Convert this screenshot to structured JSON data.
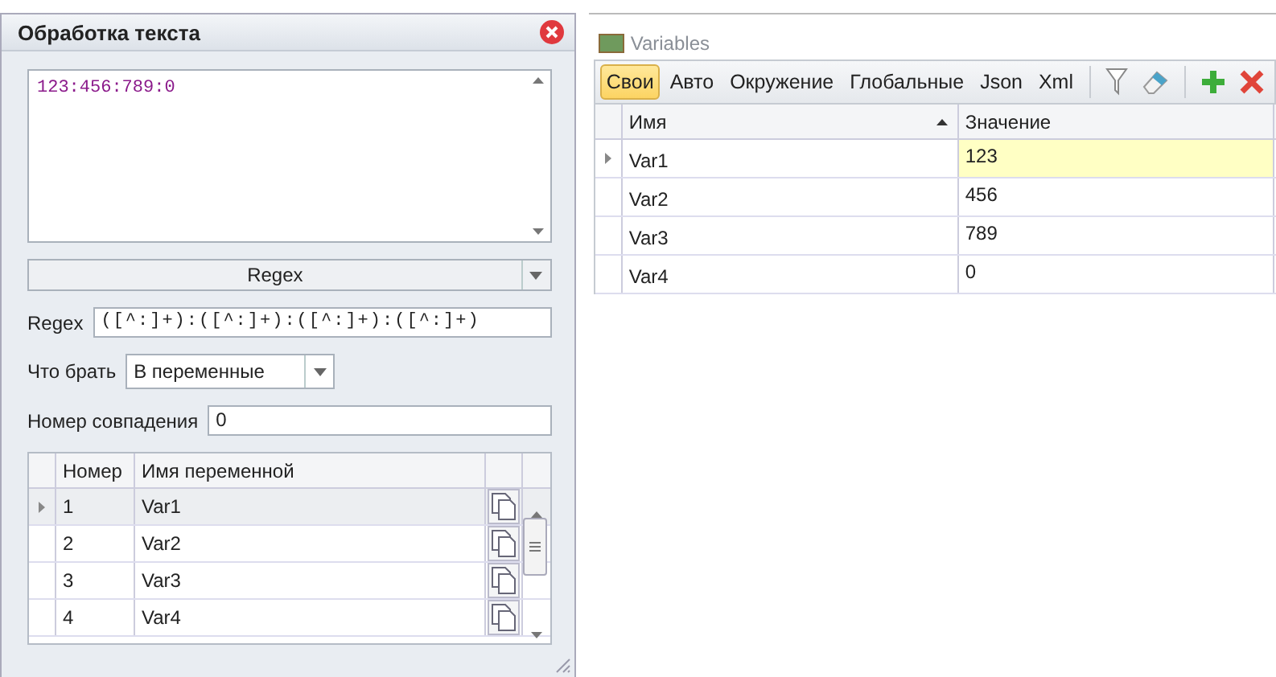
{
  "panel": {
    "title": "Обработка текста",
    "text": "123:456:789:0",
    "mode": "Regex",
    "regex": {
      "label": "Regex",
      "value": "([^:]+):([^:]+):([^:]+):([^:]+)"
    },
    "take": {
      "label": "Что брать",
      "value": "В переменные"
    },
    "match": {
      "label": "Номер совпадения",
      "value": "0"
    },
    "table": {
      "columns": [
        "Номер",
        "Имя переменной"
      ],
      "rows": [
        {
          "number": "1",
          "name": "Var1",
          "selected": true
        },
        {
          "number": "2",
          "name": "Var2",
          "selected": false
        },
        {
          "number": "3",
          "name": "Var3",
          "selected": false
        },
        {
          "number": "4",
          "name": "Var4",
          "selected": false
        }
      ]
    }
  },
  "variables": {
    "title": "Variables",
    "tabs": [
      {
        "label": "Свои",
        "selected": true
      },
      {
        "label": "Авто",
        "selected": false
      },
      {
        "label": "Окружение",
        "selected": false
      },
      {
        "label": "Глобальные",
        "selected": false
      },
      {
        "label": "Json",
        "selected": false
      },
      {
        "label": "Xml",
        "selected": false
      }
    ],
    "columns": [
      {
        "label": "Имя",
        "sorted": true
      },
      {
        "label": "Значение",
        "sorted": false
      }
    ],
    "rows": [
      {
        "name": "Var1",
        "value": "123",
        "selected": true
      },
      {
        "name": "Var2",
        "value": "456",
        "selected": false
      },
      {
        "name": "Var3",
        "value": "789",
        "selected": false
      },
      {
        "name": "Var4",
        "value": "0",
        "selected": false
      }
    ]
  }
}
